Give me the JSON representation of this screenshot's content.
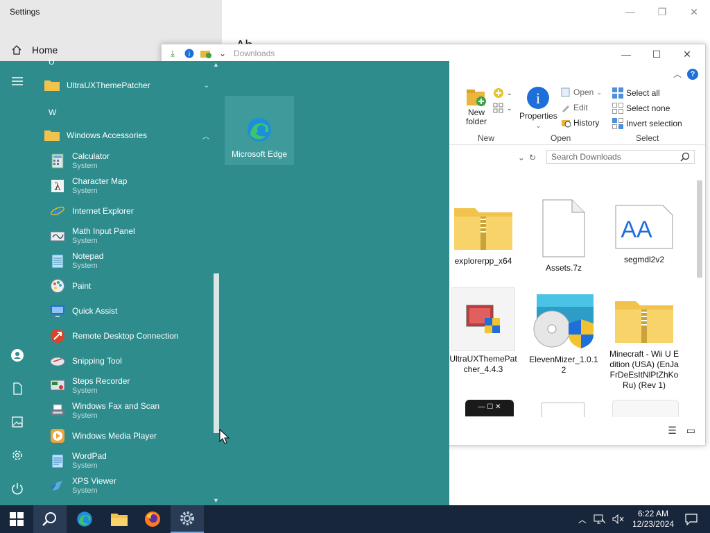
{
  "settings": {
    "title": "Settings",
    "home_label": "Home",
    "right_heading": "Ab"
  },
  "explorer": {
    "qat_title": "Downloads",
    "ribbon": {
      "new_folder_label": "New folder",
      "group_new": "New",
      "properties_label": "Properties",
      "open_label": "Open",
      "edit_label": "Edit",
      "history_label": "History",
      "group_open": "Open",
      "select_all_label": "Select all",
      "select_none_label": "Select none",
      "invert_selection_label": "Invert selection",
      "group_select": "Select"
    },
    "search_placeholder": "Search Downloads",
    "files": [
      {
        "name": "explorerpp_x64"
      },
      {
        "name": "Assets.7z"
      },
      {
        "name": "segmdl2v2"
      },
      {
        "name": "UltraUXThemePatcher_4.4.3"
      },
      {
        "name": "ElevenMizer_1.0.12"
      },
      {
        "name": "Minecraft - Wii U Edition (USA) (EnJaFrDeEsItNlPtZhKoRu) (Rev 1)"
      }
    ]
  },
  "start_menu": {
    "letter_u": "U",
    "folder_ultraux": "UltraUXThemePatcher",
    "letter_w": "W",
    "folder_accessories": "Windows Accessories",
    "apps": [
      {
        "name": "Calculator",
        "sub": "System"
      },
      {
        "name": "Character Map",
        "sub": "System"
      },
      {
        "name": "Internet Explorer",
        "sub": ""
      },
      {
        "name": "Math Input Panel",
        "sub": "System"
      },
      {
        "name": "Notepad",
        "sub": "System"
      },
      {
        "name": "Paint",
        "sub": ""
      },
      {
        "name": "Quick Assist",
        "sub": ""
      },
      {
        "name": "Remote Desktop Connection",
        "sub": ""
      },
      {
        "name": "Snipping Tool",
        "sub": ""
      },
      {
        "name": "Steps Recorder",
        "sub": "System"
      },
      {
        "name": "Windows Fax and Scan",
        "sub": "System"
      },
      {
        "name": "Windows Media Player",
        "sub": ""
      },
      {
        "name": "WordPad",
        "sub": "System"
      },
      {
        "name": "XPS Viewer",
        "sub": "System"
      }
    ],
    "tile_edge": "Microsoft Edge"
  },
  "taskbar": {
    "time": "6:22 AM",
    "date": "12/23/2024"
  },
  "colors": {
    "start_bg": "#2e8c8d",
    "taskbar_bg": "#17263b",
    "accent": "#1e6fd9"
  }
}
